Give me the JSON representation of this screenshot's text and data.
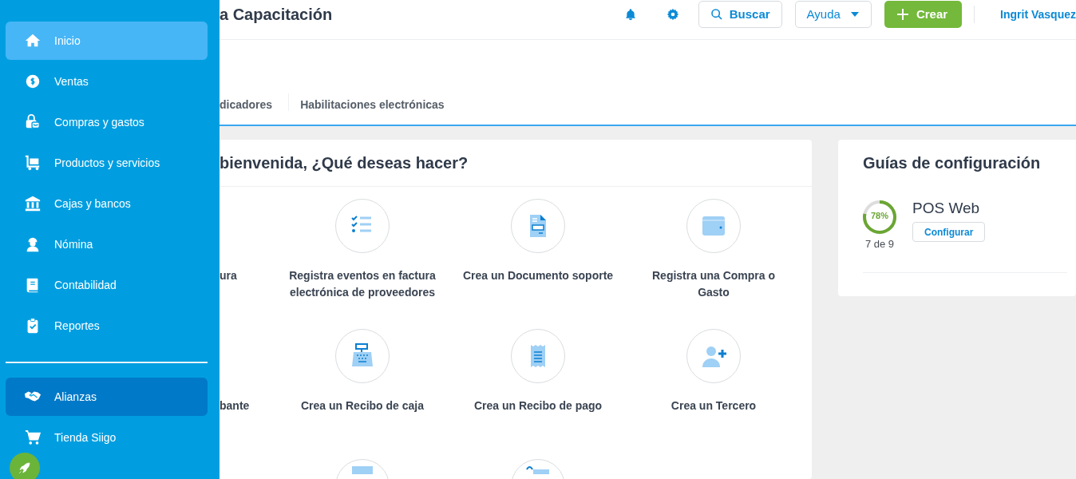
{
  "sidebar": {
    "items": [
      {
        "label": "Inicio",
        "selected": true,
        "hovered": false
      },
      {
        "label": "Ventas",
        "selected": false,
        "hovered": false
      },
      {
        "label": "Compras y gastos",
        "selected": false,
        "hovered": false
      },
      {
        "label": "Productos y servicios",
        "selected": false,
        "hovered": false
      },
      {
        "label": "Cajas y bancos",
        "selected": false,
        "hovered": false
      },
      {
        "label": "Nómina",
        "selected": false,
        "hovered": false
      },
      {
        "label": "Contabilidad",
        "selected": false,
        "hovered": false
      },
      {
        "label": "Reportes",
        "selected": false,
        "hovered": false
      }
    ],
    "bottom_items": [
      {
        "label": "Alianzas",
        "selected": false,
        "hovered": true
      },
      {
        "label": "Tienda Siigo",
        "selected": false,
        "hovered": false
      }
    ]
  },
  "header": {
    "title": "a Capacitación",
    "search_button": "Buscar",
    "help_button": "Ayuda",
    "create_button": "Crear",
    "user": "Ingrit Vasquez"
  },
  "tabs": [
    {
      "label": "dicadores",
      "selected": false
    },
    {
      "label": "Habilitaciones electrónicas",
      "selected": false
    }
  ],
  "actions_card": {
    "title": "bienvenida, ¿Qué deseas hacer?",
    "actions": [
      {
        "kind": "partial",
        "label": "ura"
      },
      {
        "kind": "full",
        "label": "Registra eventos en factura electrónica de proveedores"
      },
      {
        "kind": "full",
        "label": "Crea un Documento soporte"
      },
      {
        "kind": "full",
        "label": "Registra una Compra o Gasto"
      },
      {
        "kind": "partial",
        "label": "bante"
      },
      {
        "kind": "full",
        "label": "Crea un Recibo de caja"
      },
      {
        "kind": "full",
        "label": "Crea un Recibo de pago"
      },
      {
        "kind": "full",
        "label": "Crea un Tercero"
      },
      {
        "kind": "blank"
      },
      {
        "kind": "icon"
      },
      {
        "kind": "icon"
      }
    ]
  },
  "guides_card": {
    "title": "Guías de configuración",
    "guides": [
      {
        "name": "POS Web",
        "level": 0.78,
        "percent": "78%",
        "progress": "7 de 9",
        "button": "Configurar"
      }
    ]
  }
}
